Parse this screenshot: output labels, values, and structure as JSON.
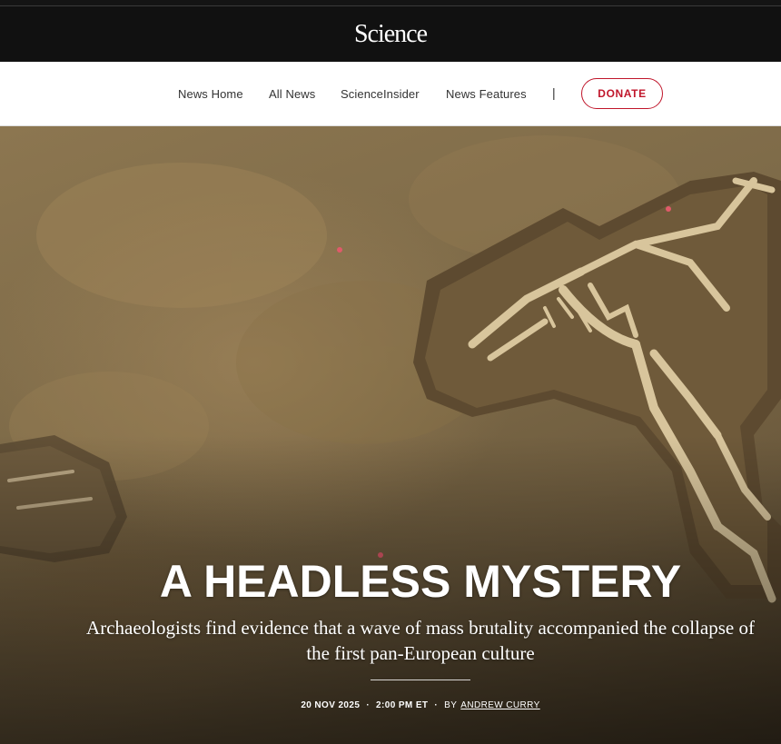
{
  "masthead": {
    "logo_text": "Science"
  },
  "nav": {
    "items": [
      {
        "label": "News Home"
      },
      {
        "label": "All News"
      },
      {
        "label": "ScienceInsider"
      },
      {
        "label": "News Features"
      }
    ],
    "separator": "|",
    "donate_label": "DONATE"
  },
  "hero": {
    "image_icon": "excavation-skeletons-photo",
    "headline": "A HEADLESS MYSTERY",
    "dek": "Archaeologists find evidence that a wave of mass brutality accompanied the collapse of the first pan-European culture",
    "date": "20 NOV 2025",
    "time": "2:00 PM ET",
    "byline_prefix": "BY",
    "author": "ANDREW CURRY"
  },
  "colors": {
    "accent": "#c0162b",
    "masthead_bg": "#111111"
  }
}
